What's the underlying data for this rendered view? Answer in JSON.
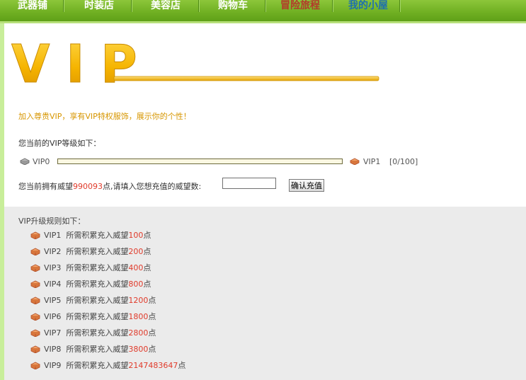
{
  "nav": {
    "items": [
      {
        "label": "武器铺",
        "color": "#ffffff"
      },
      {
        "label": "时装店",
        "color": "#ffffff"
      },
      {
        "label": "美容店",
        "color": "#ffffff"
      },
      {
        "label": "购物车",
        "color": "#ffffff"
      },
      {
        "label": "冒险旅程",
        "color": "#b33a2a"
      },
      {
        "label": "我的小屋",
        "color": "#1d6fb0"
      }
    ]
  },
  "logo": {
    "text": "VIP"
  },
  "intro": "加入尊贵VIP，享有VIP特权服饰，展示你的个性！",
  "vip_status": {
    "heading": "您当前的VIP等级如下：",
    "current_level": "VIP0",
    "next_level": "VIP1",
    "progress_text": "[0/100]",
    "progress": 0
  },
  "recharge": {
    "prefix": "您当前拥有威望",
    "points": "990093",
    "suffix": "点,请填入您想充值的威望数:",
    "input_value": "",
    "button_label": "确认充值"
  },
  "rules": {
    "heading": "VIP升级规则如下：",
    "items": [
      {
        "level": "VIP1",
        "text": "所需积累充入威望",
        "amount": "100",
        "unit": "点"
      },
      {
        "level": "VIP2",
        "text": "所需积累充入威望",
        "amount": "200",
        "unit": "点"
      },
      {
        "level": "VIP3",
        "text": "所需积累充入威望",
        "amount": "400",
        "unit": "点"
      },
      {
        "level": "VIP4",
        "text": "所需积累充入威望",
        "amount": "800",
        "unit": "点"
      },
      {
        "level": "VIP5",
        "text": "所需积累充入威望",
        "amount": "1200",
        "unit": "点"
      },
      {
        "level": "VIP6",
        "text": "所需积累充入威望",
        "amount": "1800",
        "unit": "点"
      },
      {
        "level": "VIP7",
        "text": "所需积累充入威望",
        "amount": "2800",
        "unit": "点"
      },
      {
        "level": "VIP8",
        "text": "所需积累充入威望",
        "amount": "3800",
        "unit": "点"
      },
      {
        "level": "VIP9",
        "text": "所需积累充入威望",
        "amount": "2147483647",
        "unit": "点"
      }
    ]
  }
}
